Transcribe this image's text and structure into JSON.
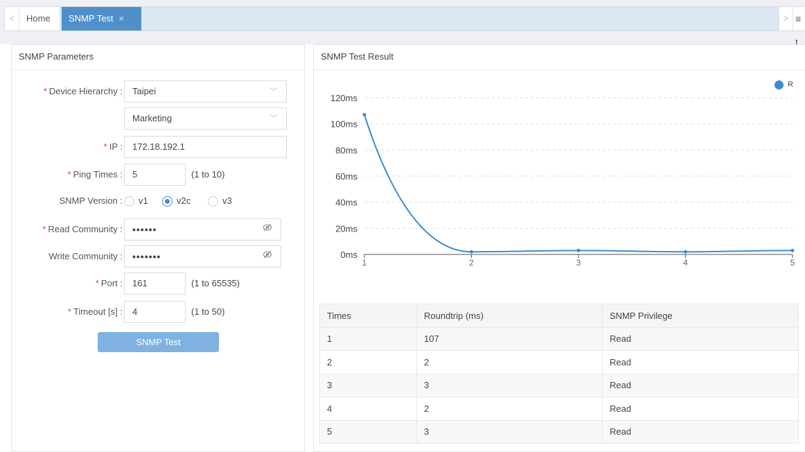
{
  "tabs": {
    "home_label": "Home",
    "active_label": "SNMP Test",
    "close_glyph": "×",
    "scroll_left_glyph": "<",
    "scroll_right_glyph": ">",
    "menu_glyph": "≡ t"
  },
  "params": {
    "title": "SNMP Parameters",
    "device_hierarchy": {
      "label": "Device Hierarchy :",
      "level1": "Taipei",
      "level2": "Marketing"
    },
    "ip": {
      "label": "IP :",
      "value": "172.18.192.1"
    },
    "ping_times": {
      "label": "Ping Times :",
      "value": "5",
      "hint": "(1 to 10)"
    },
    "snmp_version": {
      "label": "SNMP Version :",
      "options": [
        "v1",
        "v2c",
        "v3"
      ],
      "selected": "v2c"
    },
    "read_community": {
      "label": "Read Community :",
      "value": "••••••"
    },
    "write_community": {
      "label": "Write Community :",
      "value": "•••••••"
    },
    "port": {
      "label": "Port :",
      "value": "161",
      "hint": "(1 to 65535)"
    },
    "timeout": {
      "label": "Timeout [s] :",
      "value": "4",
      "hint": "(1 to 50)"
    },
    "required_mark": "*",
    "submit_label": "SNMP Test",
    "icons": {
      "select": "chevron-down-icon",
      "password": "eye-off-icon"
    }
  },
  "result": {
    "title": "SNMP Test Result",
    "legend_label": "R",
    "table": {
      "headers": [
        "Times",
        "Roundtrip (ms)",
        "SNMP Privilege"
      ],
      "rows": [
        [
          "1",
          "107",
          "Read"
        ],
        [
          "2",
          "2",
          "Read"
        ],
        [
          "3",
          "3",
          "Read"
        ],
        [
          "4",
          "2",
          "Read"
        ],
        [
          "5",
          "3",
          "Read"
        ]
      ]
    }
  },
  "colors": {
    "accent": "#4f90cb",
    "line": "#3d8bd0",
    "button": "#7fb2e1",
    "required": "#dd4444"
  },
  "chart_data": {
    "type": "line",
    "x": [
      1,
      2,
      3,
      4,
      5
    ],
    "series": [
      {
        "name": "R",
        "values": [
          107,
          2,
          3,
          2,
          3
        ]
      }
    ],
    "y_ticks": [
      "0ms",
      "20ms",
      "40ms",
      "60ms",
      "80ms",
      "100ms",
      "120ms"
    ],
    "x_ticks": [
      "1",
      "2",
      "3",
      "4",
      "5"
    ],
    "ylim": [
      0,
      120
    ],
    "grid": true,
    "legend": "top-right"
  }
}
